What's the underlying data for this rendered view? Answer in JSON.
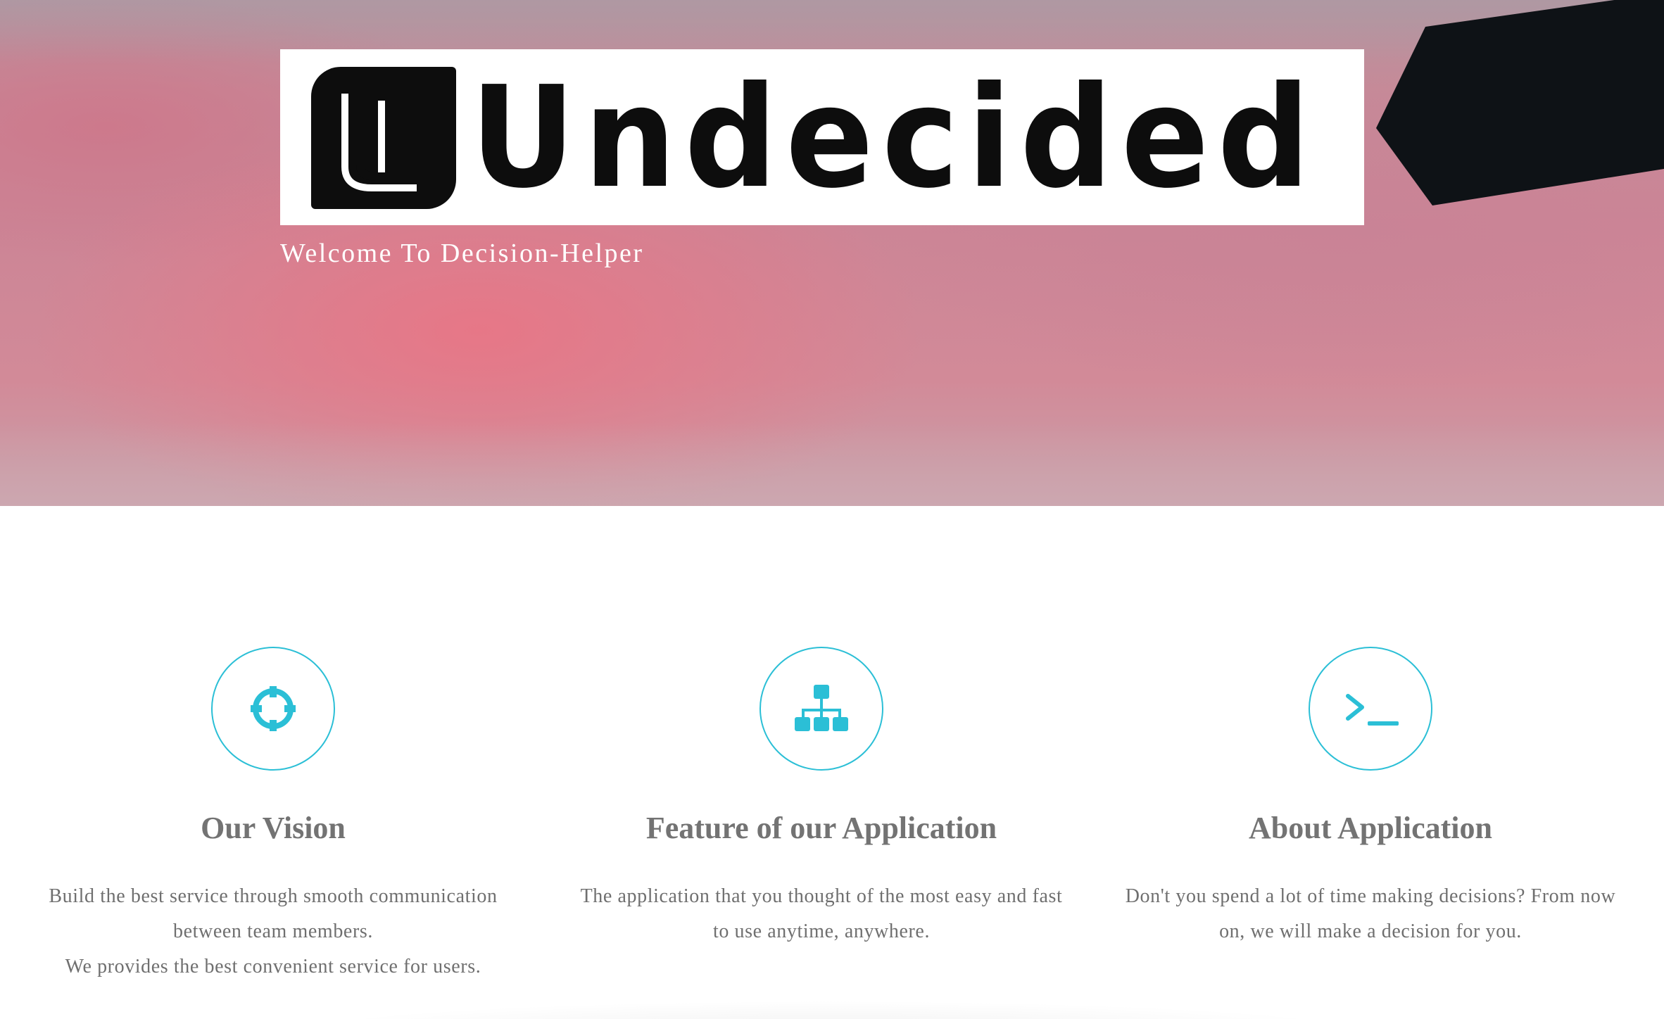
{
  "hero": {
    "logo_badge_letter": "U",
    "logo_word": "Undecided",
    "welcome": "Welcome To Decision-Helper"
  },
  "features": [
    {
      "icon": "crosshairs-icon",
      "title": "Our Vision",
      "desc_lines": [
        "Build the best service through smooth communication",
        "between team members.",
        "We provides the best convenient service for users."
      ]
    },
    {
      "icon": "sitemap-icon",
      "title": "Feature of our Application",
      "desc_lines": [
        "The application that you thought of the most easy and fast",
        "to use anytime, anywhere."
      ]
    },
    {
      "icon": "terminal-icon",
      "title": "About Application",
      "desc_lines": [
        "Don't you spend a lot of time making decisions? From now",
        "on, we will make a decision for you."
      ]
    }
  ],
  "colors": {
    "accent": "#2bbfd6",
    "heading": "#737373",
    "body_text": "#6f6f6f",
    "logo_black": "#0d0d0d"
  }
}
